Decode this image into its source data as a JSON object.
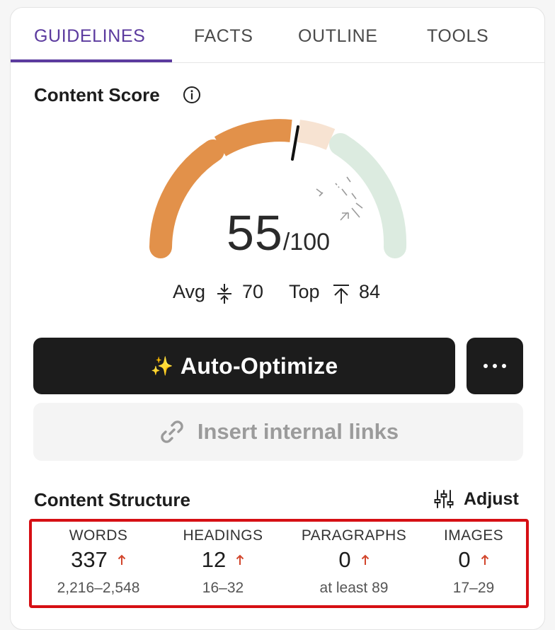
{
  "tabs": [
    {
      "label": "GUIDELINES",
      "active": true
    },
    {
      "label": "FACTS",
      "active": false
    },
    {
      "label": "OUTLINE",
      "active": false
    },
    {
      "label": "TOOLS",
      "active": false
    }
  ],
  "content_score": {
    "title": "Content Score",
    "info_icon": "info-circle-icon",
    "score": "55",
    "max": "/100",
    "score_fraction": 0.55,
    "avg_label": "Avg",
    "avg_value": "70",
    "avg_icon": "compress-arrows-icon",
    "top_label": "Top",
    "top_value": "84",
    "top_icon": "arrow-up-to-line-icon",
    "colors": {
      "filled": "#e2914a",
      "remaining_light": "#f7e3d2",
      "target_zone": "#dcebe0",
      "needle": "#111111"
    }
  },
  "actions": {
    "auto_optimize_icon": "sparkles-icon",
    "auto_optimize_label": "Auto-Optimize",
    "more_icon": "more-horizontal-icon",
    "insert_links_icon": "link-icon",
    "insert_links_label": "Insert internal links"
  },
  "content_structure": {
    "title": "Content Structure",
    "adjust_icon": "sliders-icon",
    "adjust_label": "Adjust",
    "metrics": [
      {
        "label": "WORDS",
        "value": "337",
        "range": "2,216–2,548",
        "trend": "up"
      },
      {
        "label": "HEADINGS",
        "value": "12",
        "range": "16–32",
        "trend": "up"
      },
      {
        "label": "PARAGRAPHS",
        "value": "0",
        "range": "at least 89",
        "trend": "up"
      },
      {
        "label": "IMAGES",
        "value": "0",
        "range": "17–29",
        "trend": "up"
      }
    ],
    "highlight_color": "#d60f14",
    "trend_color": "#d2452b"
  }
}
